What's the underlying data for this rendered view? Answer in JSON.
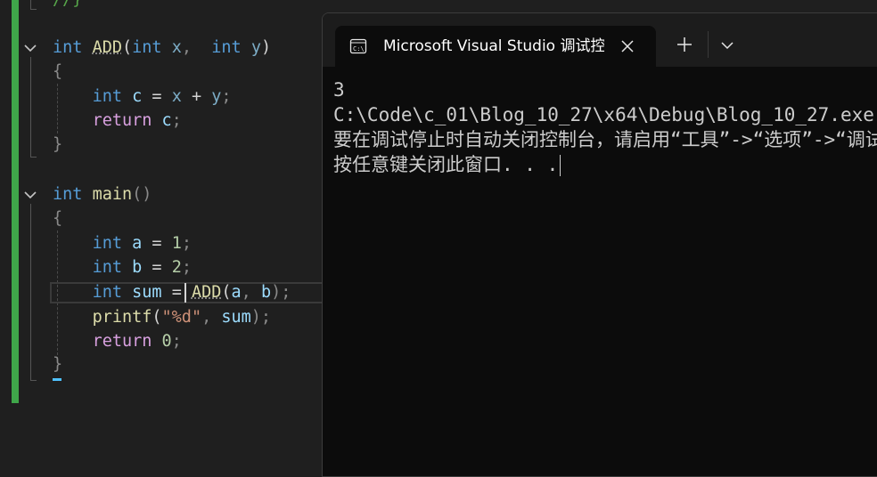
{
  "editor": {
    "top_comment": "//}",
    "add_func": {
      "ret_type": "int",
      "name": "ADD",
      "open_paren": "(",
      "p1_type": "int",
      "p1_name": "x",
      "comma": ",",
      "p2_type": "int",
      "p2_name": "y",
      "close_paren": ")",
      "open_brace": "{",
      "line1_type": "int",
      "line1_var": "c",
      "line1_eq": "=",
      "line1_a": "x",
      "line1_op": "+",
      "line1_b": "y",
      "line1_semi": ";",
      "line2_kw": "return",
      "line2_var": "c",
      "line2_semi": ";",
      "close_brace": "}"
    },
    "main_func": {
      "ret_type": "int",
      "name": "main",
      "parens": "()",
      "open_brace": "{",
      "a_type": "int",
      "a_var": "a",
      "a_eq": "=",
      "a_val": "1",
      "a_semi": ";",
      "b_type": "int",
      "b_var": "b",
      "b_eq": "=",
      "b_val": "2",
      "b_semi": ";",
      "sum_type": "int",
      "sum_var": "sum",
      "sum_eq": "=",
      "sum_call": "ADD",
      "sum_open": "(",
      "sum_arg1": "a",
      "sum_comma": ",",
      "sum_arg2": "b",
      "sum_close": ");",
      "printf_name": "printf",
      "printf_open": "(",
      "printf_q1": "\"",
      "printf_fmt": "%d",
      "printf_q2": "\"",
      "printf_comma": ",",
      "printf_arg": "sum",
      "printf_close": ");",
      "ret_kw": "return",
      "ret_val": "0",
      "ret_semi": ";",
      "close_brace": "}"
    }
  },
  "terminal": {
    "tab_title": "Microsoft Visual Studio 调试控制台",
    "tab_icon": "console-icon",
    "close_icon": "close-icon",
    "new_tab_icon": "plus-icon",
    "dropdown_icon": "chevron-down-icon",
    "lines": [
      "3",
      "C:\\Code\\c_01\\Blog_10_27\\x64\\Debug\\Blog_10_27.exe",
      "要在调试停止时自动关闭控制台，请启用“工具”->“选项”->“调试”->“调试停止时自动关闭控制台”。",
      "按任意键关闭此窗口. . ."
    ]
  },
  "colors": {
    "editor_bg": "#1f1f1f",
    "terminal_bg": "#0c0c0c",
    "keyword": "#569cd6",
    "function": "#dcdcaa",
    "variable": "#9cdcfe",
    "control": "#d8a0df",
    "number": "#b5cea8",
    "string": "#ce9178",
    "change_bar": "#3fa64a"
  }
}
